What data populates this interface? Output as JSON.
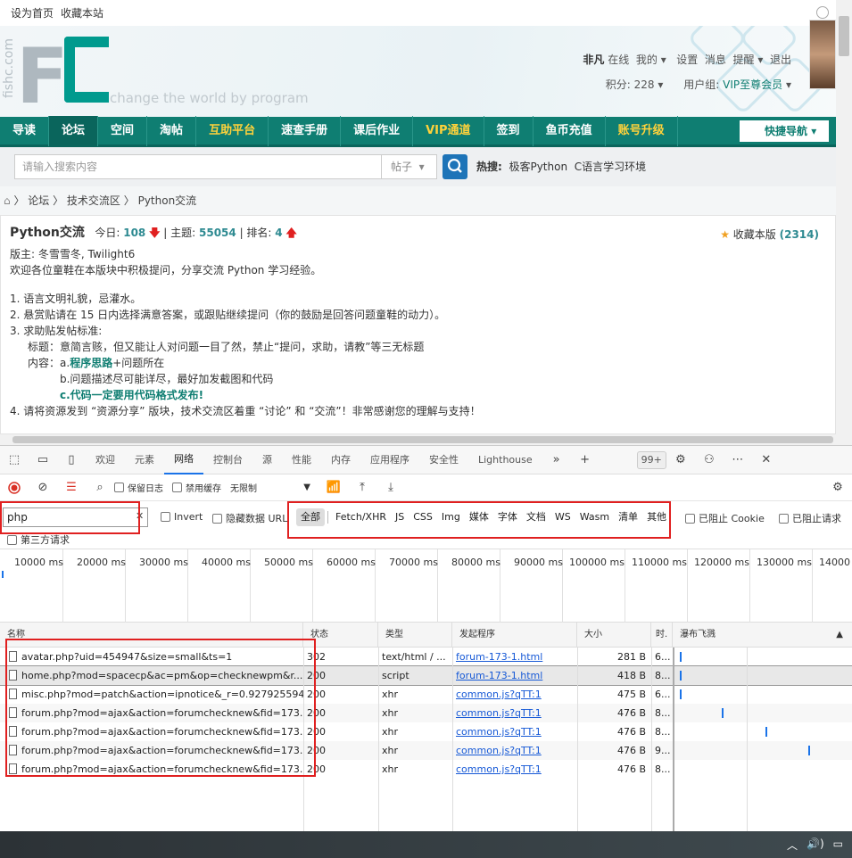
{
  "browser_top": {
    "set_home": "设为首页",
    "bookmark": "收藏本站"
  },
  "site": {
    "side_text": "fishc.com",
    "slogan": "change the world by program"
  },
  "user": {
    "name": "非凡",
    "status": "在线",
    "my": "我的",
    "settings": "设置",
    "messages": "消息",
    "reminders": "提醒",
    "logout": "退出",
    "points_label": "积分: 228",
    "group_label": "用户组:",
    "group": "VIP至尊会员"
  },
  "nav": {
    "items": [
      {
        "label": "导读",
        "style": "normal"
      },
      {
        "label": "论坛",
        "style": "active"
      },
      {
        "label": "空间",
        "style": "normal"
      },
      {
        "label": "淘帖",
        "style": "normal"
      },
      {
        "label": "互助平台",
        "style": "gold"
      },
      {
        "label": "速查手册",
        "style": "normal"
      },
      {
        "label": "课后作业",
        "style": "normal"
      },
      {
        "label": "VIP通道",
        "style": "gold"
      },
      {
        "label": "签到",
        "style": "normal"
      },
      {
        "label": "鱼币充值",
        "style": "normal"
      },
      {
        "label": "账号升级",
        "style": "gold"
      }
    ],
    "quick": "快捷导航"
  },
  "search": {
    "placeholder": "请输入搜索内容",
    "type": "帖子",
    "hot_label": "热搜:",
    "hot": [
      "极客Python",
      "C语言学习环境"
    ]
  },
  "breadcrumb": [
    "论坛",
    "技术交流区",
    "Python交流"
  ],
  "forum": {
    "title": "Python交流",
    "today_label": "今日:",
    "today": "108",
    "topics_label": "主题:",
    "topics": "55054",
    "rank_label": "排名:",
    "rank": "4",
    "fav_label": "收藏本版",
    "fav_count": "(2314)",
    "moderators": "版主: 冬雪雪冬, Twilight6",
    "welcome": "欢迎各位童鞋在本版块中积极提问，分享交流 Python 学习经验。",
    "rules": [
      "1. 语言文明礼貌，忌灌水。",
      "2. 悬赏贴请在 15 日内选择满意答案，或跟贴继续提问（你的鼓励是回答问题童鞋的动力）。",
      "3. 求助贴发帖标准:"
    ],
    "rule_title": "标题：意简言赅，但又能让人对问题一目了然，禁止“提问，求助，请教”等三无标题",
    "rule_content_label": "内容：",
    "rule_a_prefix": "a.",
    "rule_a_green": "程序思路",
    "rule_a_rest": "+问题所在",
    "rule_b": "b.问题描述尽可能详尽，最好加发截图和代码",
    "rule_c": "c.代码一定要用代码格式发布!",
    "rule4": "4. 请将资源发到 “资源分享” 版块，技术交流区着重 “讨论” 和 “交流”！非常感谢您的理解与支持！"
  },
  "devtools": {
    "tabs": [
      "欢迎",
      "元素",
      "网络",
      "控制台",
      "源",
      "性能",
      "内存",
      "应用程序",
      "安全性",
      "Lighthouse"
    ],
    "active_tab": "网络",
    "badge": "99+",
    "toolbar": {
      "preserve_log": "保留日志",
      "disable_cache": "禁用缓存",
      "throttle": "无限制"
    },
    "filter": {
      "value": "php",
      "invert": "Invert",
      "hide_data_url": "隐藏数据 URL",
      "types": [
        "全部",
        "Fetch/XHR",
        "JS",
        "CSS",
        "Img",
        "媒体",
        "字体",
        "文档",
        "WS",
        "Wasm",
        "清单",
        "其他"
      ],
      "blocked_cookie": "已阻止 Cookie",
      "blocked_requests": "已阻止请求",
      "third_party": "第三方请求"
    },
    "timeline_ticks": [
      "10000 ms",
      "20000 ms",
      "30000 ms",
      "40000 ms",
      "50000 ms",
      "60000 ms",
      "70000 ms",
      "80000 ms",
      "90000 ms",
      "100000 ms",
      "110000 ms",
      "120000 ms",
      "130000 ms",
      "14000"
    ],
    "columns": [
      "名称",
      "状态",
      "类型",
      "发起程序",
      "大小",
      "时.",
      "瀑布飞溅"
    ],
    "rows": [
      {
        "name": "avatar.php?uid=454947&size=small&ts=1",
        "status": "302",
        "type": "text/html / ...",
        "initiator": "forum-173-1.html",
        "size": "281 B",
        "time": "6..."
      },
      {
        "name": "home.php?mod=spacecp&ac=pm&op=checknewpm&r...",
        "status": "200",
        "type": "script",
        "initiator": "forum-173-1.html",
        "size": "418 B",
        "time": "8..."
      },
      {
        "name": "misc.php?mod=patch&action=ipnotice&_r=0.927925594...",
        "status": "200",
        "type": "xhr",
        "initiator": "common.js?qTT:1",
        "size": "475 B",
        "time": "6..."
      },
      {
        "name": "forum.php?mod=ajax&action=forumchecknew&fid=173...",
        "status": "200",
        "type": "xhr",
        "initiator": "common.js?qTT:1",
        "size": "476 B",
        "time": "8..."
      },
      {
        "name": "forum.php?mod=ajax&action=forumchecknew&fid=173...",
        "status": "200",
        "type": "xhr",
        "initiator": "common.js?qTT:1",
        "size": "476 B",
        "time": "8..."
      },
      {
        "name": "forum.php?mod=ajax&action=forumchecknew&fid=173...",
        "status": "200",
        "type": "xhr",
        "initiator": "common.js?qTT:1",
        "size": "476 B",
        "time": "9..."
      },
      {
        "name": "forum.php?mod=ajax&action=forumchecknew&fid=173...",
        "status": "200",
        "type": "xhr",
        "initiator": "common.js?qTT:1",
        "size": "476 B",
        "time": "8..."
      }
    ]
  },
  "taskbar": {
    "volume": "🔊)"
  }
}
